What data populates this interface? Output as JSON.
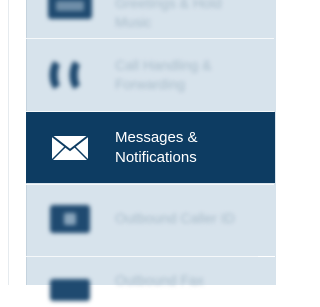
{
  "sidebar": {
    "items": [
      {
        "label": "Greetings & Hold Music",
        "icon": "hold-music-icon",
        "state": "blurred"
      },
      {
        "label": "Call Handling & Forwarding",
        "icon": "call-forwarding-icon",
        "state": "blurred"
      },
      {
        "label": "Messages & Notifications",
        "icon": "envelope-icon",
        "state": "active"
      },
      {
        "label": "Outbound Caller ID",
        "icon": "caller-id-icon",
        "state": "blurred"
      },
      {
        "label": "Outbound Fax",
        "icon": "fax-icon",
        "state": "blurred"
      }
    ]
  },
  "colors": {
    "sidebar_bg": "#d7e3ec",
    "active_bg": "#0d3c62",
    "active_text": "#ffffff",
    "inactive_text": "#9fb3c3",
    "icon_dark": "#1f4a70"
  }
}
